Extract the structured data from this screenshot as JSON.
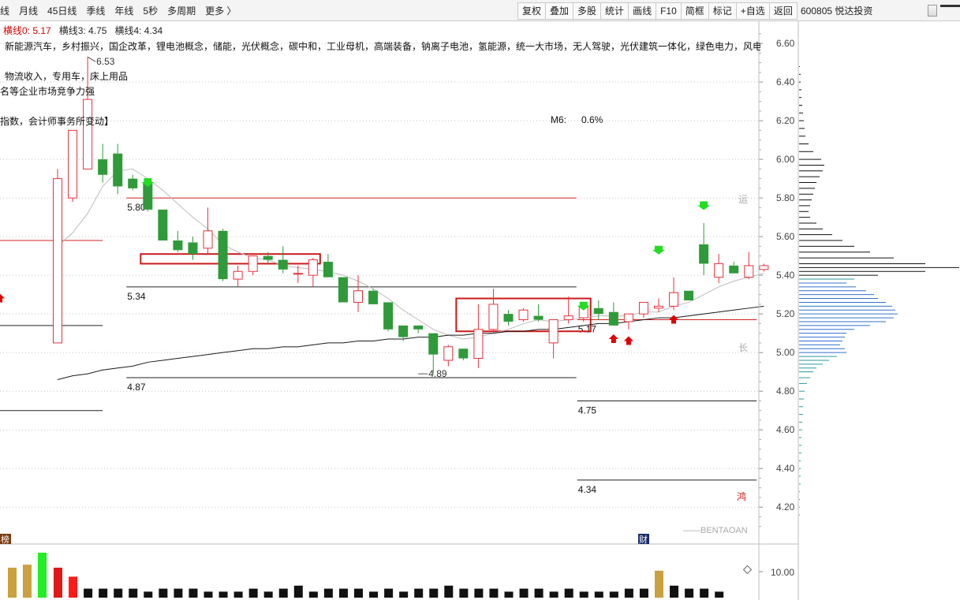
{
  "toolbar": {
    "periods": [
      "线",
      "月线",
      "45日线",
      "季线",
      "年线",
      "5秒",
      "多周期",
      "更多 〉"
    ],
    "buttons": [
      "复权",
      "叠加",
      "多股",
      "统计",
      "画线",
      "F10",
      "简框",
      "标记",
      "+自选",
      "返回"
    ],
    "stock": "600805 悦达投资"
  },
  "info": {
    "hline0_label": "横线0: 5.17",
    "hline3_label": "横线3: 4.75",
    "hline4_label": "横线4: 4.34",
    "concepts": "新能源汽车，乡村振兴，国企改革，锂电池概念，储能，光伏概念，碳中和，工业母机，高端装备，钠离子电池，氢能源，统一大市场，无人驾驶，光伏建筑一体化，绿色电力，风电",
    "line2": "物流收入，专用车，床上用品",
    "line3": "名等企业市场竞争力强",
    "line4": "指数，会计师事务所变动】",
    "m6_label": "M6:",
    "m6_value": "0.6%"
  },
  "side_labels": {
    "yun": "运",
    "chang": "长",
    "hong": "鸿"
  },
  "markers": {
    "bang": "榜",
    "cai": "财"
  },
  "watermark": "——BENTAOAN",
  "colors": {
    "up": "#e8323c",
    "down": "#2f9a3a",
    "volume_special": "#caa040",
    "volume_up_bright": "#ff1a1a",
    "volume_bright_green": "#22ee22",
    "arrow_green": "#22dd22",
    "arrow_red": "#e00000",
    "profile_dark": "#111111",
    "profile_teal": "#2a9a9a",
    "profile_blue": "#3070d0",
    "box": "#cc1a1a"
  },
  "chart_data": {
    "type": "candlestick",
    "y_ticks": [
      "6.60",
      "6.40",
      "6.20",
      "6.00",
      "5.80",
      "5.60",
      "5.40",
      "5.20",
      "5.00",
      "4.80",
      "4.60",
      "4.40",
      "4.20"
    ],
    "ylim": [
      4.05,
      6.69
    ],
    "volume_tick": "10.00",
    "candles": [
      {
        "o": 5.05,
        "h": 5.95,
        "l": 5.05,
        "c": 5.9
      },
      {
        "o": 5.8,
        "h": 6.05,
        "l": 5.78,
        "c": 6.15
      },
      {
        "o": 5.95,
        "h": 6.53,
        "l": 5.96,
        "c": 6.31
      },
      {
        "o": 6.0,
        "h": 6.08,
        "l": 5.88,
        "c": 5.92
      },
      {
        "o": 6.03,
        "h": 6.08,
        "l": 5.82,
        "c": 5.86
      },
      {
        "o": 5.9,
        "h": 5.92,
        "l": 5.84,
        "c": 5.85
      },
      {
        "o": 5.88,
        "h": 5.9,
        "l": 5.73,
        "c": 5.74
      },
      {
        "o": 5.74,
        "h": 5.74,
        "l": 5.58,
        "c": 5.58
      },
      {
        "o": 5.58,
        "h": 5.63,
        "l": 5.52,
        "c": 5.53
      },
      {
        "o": 5.57,
        "h": 5.6,
        "l": 5.48,
        "c": 5.51
      },
      {
        "o": 5.54,
        "h": 5.75,
        "l": 5.51,
        "c": 5.63
      },
      {
        "o": 5.63,
        "h": 5.64,
        "l": 5.37,
        "c": 5.38
      },
      {
        "o": 5.38,
        "h": 5.45,
        "l": 5.34,
        "c": 5.42
      },
      {
        "o": 5.42,
        "h": 5.5,
        "l": 5.4,
        "c": 5.5
      },
      {
        "o": 5.5,
        "h": 5.52,
        "l": 5.46,
        "c": 5.48
      },
      {
        "o": 5.48,
        "h": 5.55,
        "l": 5.41,
        "c": 5.43
      },
      {
        "o": 5.41,
        "h": 5.45,
        "l": 5.36,
        "c": 5.41
      },
      {
        "o": 5.4,
        "h": 5.49,
        "l": 5.34,
        "c": 5.48
      },
      {
        "o": 5.47,
        "h": 5.51,
        "l": 5.39,
        "c": 5.39
      },
      {
        "o": 5.39,
        "h": 5.39,
        "l": 5.26,
        "c": 5.26
      },
      {
        "o": 5.26,
        "h": 5.4,
        "l": 5.21,
        "c": 5.32
      },
      {
        "o": 5.32,
        "h": 5.33,
        "l": 5.25,
        "c": 5.25
      },
      {
        "o": 5.26,
        "h": 5.26,
        "l": 5.11,
        "c": 5.12
      },
      {
        "o": 5.14,
        "h": 5.14,
        "l": 5.06,
        "c": 5.08
      },
      {
        "o": 5.14,
        "h": 5.14,
        "l": 5.1,
        "c": 5.12
      },
      {
        "o": 5.1,
        "h": 5.1,
        "l": 4.89,
        "c": 4.99
      },
      {
        "o": 4.96,
        "h": 5.04,
        "l": 4.93,
        "c": 5.03
      },
      {
        "o": 5.02,
        "h": 5.02,
        "l": 4.96,
        "c": 4.97
      },
      {
        "o": 4.97,
        "h": 5.25,
        "l": 4.92,
        "c": 5.12
      },
      {
        "o": 5.12,
        "h": 5.33,
        "l": 5.1,
        "c": 5.25
      },
      {
        "o": 5.2,
        "h": 5.22,
        "l": 5.14,
        "c": 5.16
      },
      {
        "o": 5.17,
        "h": 5.23,
        "l": 5.16,
        "c": 5.22
      },
      {
        "o": 5.19,
        "h": 5.25,
        "l": 5.16,
        "c": 5.17
      },
      {
        "o": 5.05,
        "h": 5.17,
        "l": 4.97,
        "c": 5.17
      },
      {
        "o": 5.17,
        "h": 5.29,
        "l": 5.15,
        "c": 5.19
      },
      {
        "o": 5.18,
        "h": 5.25,
        "l": 5.16,
        "c": 5.24
      },
      {
        "o": 5.23,
        "h": 5.27,
        "l": 5.17,
        "c": 5.2
      },
      {
        "o": 5.21,
        "h": 5.26,
        "l": 5.14,
        "c": 5.14
      },
      {
        "o": 5.16,
        "h": 5.2,
        "l": 5.12,
        "c": 5.2
      },
      {
        "o": 5.2,
        "h": 5.26,
        "l": 5.18,
        "c": 5.26
      },
      {
        "o": 5.23,
        "h": 5.28,
        "l": 5.21,
        "c": 5.24
      },
      {
        "o": 5.24,
        "h": 5.39,
        "l": 5.22,
        "c": 5.31
      },
      {
        "o": 5.32,
        "h": 5.32,
        "l": 5.27,
        "c": 5.27
      },
      {
        "o": 5.56,
        "h": 5.67,
        "l": 5.4,
        "c": 5.46
      },
      {
        "o": 5.39,
        "h": 5.51,
        "l": 5.36,
        "c": 5.46
      },
      {
        "o": 5.45,
        "h": 5.47,
        "l": 5.41,
        "c": 5.41
      },
      {
        "o": 5.39,
        "h": 5.52,
        "l": 5.38,
        "c": 5.45
      },
      {
        "o": 5.43,
        "h": 5.46,
        "l": 5.42,
        "c": 5.45
      }
    ],
    "ma_short": [
      5.55,
      5.62,
      5.72,
      5.86,
      5.94,
      5.95,
      5.9,
      5.84,
      5.77,
      5.7,
      5.64,
      5.56,
      5.52,
      5.49,
      5.48,
      5.45,
      5.44,
      5.43,
      5.42,
      5.4,
      5.37,
      5.33,
      5.28,
      5.22,
      5.17,
      5.12,
      5.09,
      5.07,
      5.08,
      5.1,
      5.12,
      5.15,
      5.17,
      5.16,
      5.17,
      5.18,
      5.19,
      5.19,
      5.19,
      5.21,
      5.21,
      5.24,
      5.26,
      5.3,
      5.34,
      5.37,
      5.39,
      5.41
    ],
    "ma_long": [
      4.86,
      4.88,
      4.89,
      4.91,
      4.92,
      4.93,
      4.95,
      4.96,
      4.97,
      4.98,
      4.99,
      5.0,
      5.01,
      5.02,
      5.02,
      5.03,
      5.03,
      5.04,
      5.05,
      5.05,
      5.06,
      5.06,
      5.07,
      5.07,
      5.08,
      5.08,
      5.09,
      5.09,
      5.1,
      5.1,
      5.11,
      5.11,
      5.12,
      5.12,
      5.13,
      5.14,
      5.15,
      5.15,
      5.16,
      5.17,
      5.18,
      5.18,
      5.19,
      5.2,
      5.21,
      5.22,
      5.23,
      5.24
    ],
    "hlines": [
      {
        "value": 5.8,
        "label": "5.80",
        "color": "red",
        "from": 5,
        "to": 34
      },
      {
        "value": 5.58,
        "label": "",
        "color": "red",
        "from": -1,
        "to": 3
      },
      {
        "value": 5.34,
        "label": "5.34",
        "color": "black",
        "from": 5,
        "to": 34
      },
      {
        "value": 5.14,
        "label": "",
        "color": "black",
        "from": -1,
        "to": 3
      },
      {
        "value": 4.87,
        "label": "4.87",
        "color": "black",
        "from": 5,
        "to": 34
      },
      {
        "value": 4.7,
        "label": "",
        "color": "black",
        "from": -1,
        "to": 3
      },
      {
        "value": 5.17,
        "label": "5.17",
        "color": "red",
        "from": 35,
        "to": 46
      },
      {
        "value": 4.75,
        "label": "4.75",
        "color": "black",
        "from": 35,
        "to": 46
      },
      {
        "value": 4.34,
        "label": "4.34",
        "color": "black",
        "from": 35,
        "to": 46
      }
    ],
    "boxes": [
      {
        "from": 6,
        "to": 17,
        "high": 5.51,
        "low": 5.46
      },
      {
        "from": 27,
        "to": 35,
        "high": 5.28,
        "low": 5.11
      }
    ],
    "annotations": [
      {
        "candle": 2,
        "value": 6.53,
        "text": "6.53"
      },
      {
        "candle": 24,
        "value": 4.89,
        "text": "4.89"
      }
    ],
    "volumes": [
      1.0,
      1.1,
      1.5,
      1.0,
      0.7,
      0.3,
      0.3,
      0.3,
      0.3,
      0.2,
      0.3,
      0.3,
      0.3,
      0.2,
      0.2,
      0.2,
      0.3,
      0.2,
      0.3,
      0.4,
      0.2,
      0.3,
      0.3,
      0.3,
      0.2,
      0.3,
      0.2,
      0.3,
      0.3,
      0.4,
      0.3,
      0.3,
      0.3,
      0.2,
      0.3,
      0.3,
      0.2,
      0.3,
      0.2,
      0.2,
      0.2,
      0.3,
      0.3,
      0.9,
      0.4,
      0.3,
      0.3,
      0.2
    ],
    "volume_colors": [
      "special",
      "special",
      "bright_green",
      "up",
      "up_bright",
      "dark",
      "dark",
      "dark",
      "dark",
      "dark",
      "dark",
      "dark",
      "dark",
      "dark",
      "dark",
      "dark",
      "dark",
      "dark",
      "dark",
      "dark",
      "dark",
      "dark",
      "dark",
      "dark",
      "dark",
      "dark",
      "dark",
      "dark",
      "dark",
      "dark",
      "dark",
      "dark",
      "dark",
      "dark",
      "dark",
      "dark",
      "dark",
      "dark",
      "dark",
      "dark",
      "dark",
      "dark",
      "dark",
      "special",
      "dark",
      "dark",
      "dark",
      "dark"
    ],
    "down_arrows": [
      {
        "candle": 6,
        "value": 5.87
      },
      {
        "candle": 35,
        "value": 5.23
      },
      {
        "candle": 40,
        "value": 5.52
      },
      {
        "candle": 43,
        "value": 5.75
      }
    ],
    "up_arrows": [
      {
        "candle": 37,
        "value": 5.07
      },
      {
        "candle": 38,
        "value": 5.06
      },
      {
        "candle": 41,
        "value": 5.17
      },
      {
        "candle": -1,
        "value": 5.28
      }
    ],
    "profile": [
      {
        "price": 6.48,
        "len": 1
      },
      {
        "price": 6.44,
        "len": 2
      },
      {
        "price": 6.4,
        "len": 2
      },
      {
        "price": 6.36,
        "len": 3
      },
      {
        "price": 6.32,
        "len": 3
      },
      {
        "price": 6.28,
        "len": 4
      },
      {
        "price": 6.24,
        "len": 5
      },
      {
        "price": 6.2,
        "len": 6
      },
      {
        "price": 6.16,
        "len": 7
      },
      {
        "price": 6.12,
        "len": 8
      },
      {
        "price": 6.08,
        "len": 12
      },
      {
        "price": 6.04,
        "len": 18
      },
      {
        "price": 6.0,
        "len": 28
      },
      {
        "price": 5.97,
        "len": 32
      },
      {
        "price": 5.94,
        "len": 30
      },
      {
        "price": 5.91,
        "len": 26
      },
      {
        "price": 5.88,
        "len": 22
      },
      {
        "price": 5.85,
        "len": 20
      },
      {
        "price": 5.82,
        "len": 18
      },
      {
        "price": 5.79,
        "len": 16
      },
      {
        "price": 5.76,
        "len": 14
      },
      {
        "price": 5.73,
        "len": 12
      },
      {
        "price": 5.7,
        "len": 14
      },
      {
        "price": 5.67,
        "len": 22
      },
      {
        "price": 5.64,
        "len": 30
      },
      {
        "price": 5.61,
        "len": 42
      },
      {
        "price": 5.58,
        "len": 55
      },
      {
        "price": 5.55,
        "len": 70
      },
      {
        "price": 5.52,
        "len": 90
      },
      {
        "price": 5.49,
        "len": 120
      },
      {
        "price": 5.46,
        "len": 160
      },
      {
        "price": 5.44,
        "len": 205
      },
      {
        "price": 5.42,
        "len": 160
      },
      {
        "price": 5.4,
        "len": 100
      },
      {
        "price": 5.38,
        "len": 70
      },
      {
        "price": 5.36,
        "len": 60
      },
      {
        "price": 5.34,
        "len": 72
      },
      {
        "price": 5.32,
        "len": 85
      },
      {
        "price": 5.3,
        "len": 95
      },
      {
        "price": 5.28,
        "len": 100
      },
      {
        "price": 5.26,
        "len": 110
      },
      {
        "price": 5.24,
        "len": 118
      },
      {
        "price": 5.22,
        "len": 122
      },
      {
        "price": 5.2,
        "len": 125
      },
      {
        "price": 5.18,
        "len": 120
      },
      {
        "price": 5.16,
        "len": 110
      },
      {
        "price": 5.14,
        "len": 90
      },
      {
        "price": 5.12,
        "len": 70
      },
      {
        "price": 5.1,
        "len": 60
      },
      {
        "price": 5.08,
        "len": 58
      },
      {
        "price": 5.06,
        "len": 55
      },
      {
        "price": 5.04,
        "len": 52
      },
      {
        "price": 5.02,
        "len": 58
      },
      {
        "price": 5.0,
        "len": 60
      },
      {
        "price": 4.98,
        "len": 48
      },
      {
        "price": 4.96,
        "len": 38
      },
      {
        "price": 4.94,
        "len": 30
      },
      {
        "price": 4.92,
        "len": 22
      },
      {
        "price": 4.9,
        "len": 18
      },
      {
        "price": 4.87,
        "len": 14
      },
      {
        "price": 4.84,
        "len": 10
      },
      {
        "price": 4.8,
        "len": 7
      },
      {
        "price": 4.76,
        "len": 6
      },
      {
        "price": 4.72,
        "len": 5
      },
      {
        "price": 4.68,
        "len": 5
      },
      {
        "price": 4.64,
        "len": 4
      },
      {
        "price": 4.6,
        "len": 4
      },
      {
        "price": 4.56,
        "len": 3
      },
      {
        "price": 4.52,
        "len": 3
      },
      {
        "price": 4.48,
        "len": 3
      },
      {
        "price": 4.44,
        "len": 2
      },
      {
        "price": 4.4,
        "len": 2
      },
      {
        "price": 4.36,
        "len": 2
      },
      {
        "price": 4.32,
        "len": 2
      },
      {
        "price": 4.28,
        "len": 1
      },
      {
        "price": 4.24,
        "len": 1
      },
      {
        "price": 4.2,
        "len": 1
      },
      {
        "price": 4.16,
        "len": 1
      }
    ]
  }
}
